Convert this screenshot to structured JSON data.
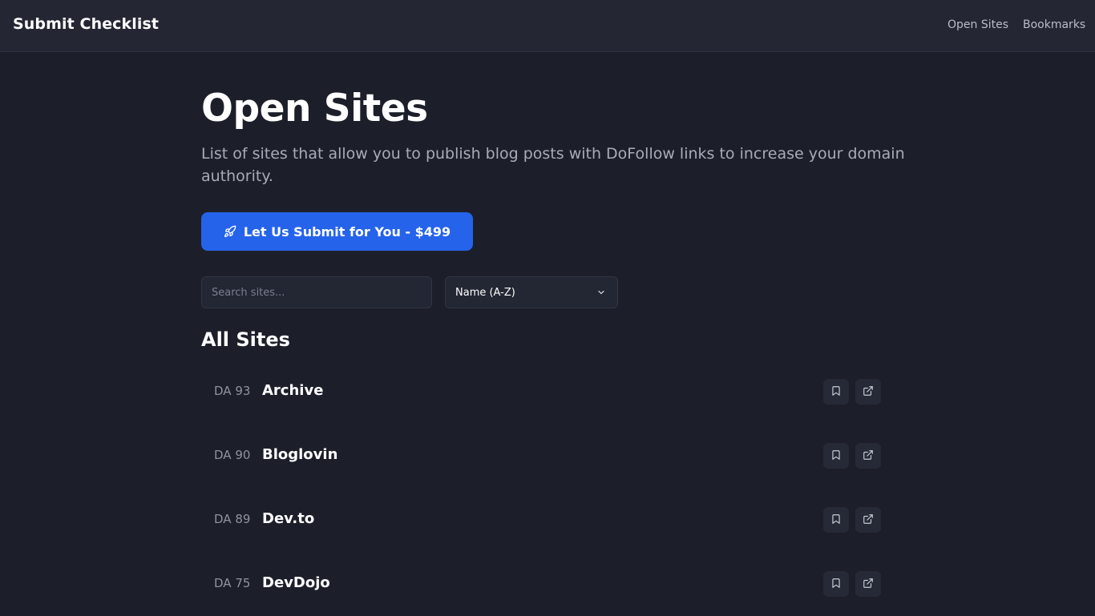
{
  "header": {
    "brand": "Submit Checklist",
    "nav": [
      {
        "label": "Open Sites"
      },
      {
        "label": "Bookmarks"
      }
    ]
  },
  "main": {
    "title": "Open Sites",
    "description": "List of sites that allow you to publish blog posts with DoFollow links to increase your domain authority.",
    "cta_label": "Let Us Submit for You - $499",
    "search_placeholder": "Search sites...",
    "sort_selected": "Name (A-Z)",
    "section_title": "All Sites",
    "sites": [
      {
        "da": "DA 93",
        "name": "Archive"
      },
      {
        "da": "DA 90",
        "name": "Bloglovin"
      },
      {
        "da": "DA 89",
        "name": "Dev.to"
      },
      {
        "da": "DA 75",
        "name": "DevDojo"
      }
    ]
  },
  "colors": {
    "background": "#1c1f2a",
    "header": "#242733",
    "accent": "#2563eb"
  },
  "icons": {
    "cta": "rocket-icon",
    "sort": "chevron-down-icon",
    "row_actions": [
      "bookmark-icon",
      "external-link-icon"
    ]
  }
}
